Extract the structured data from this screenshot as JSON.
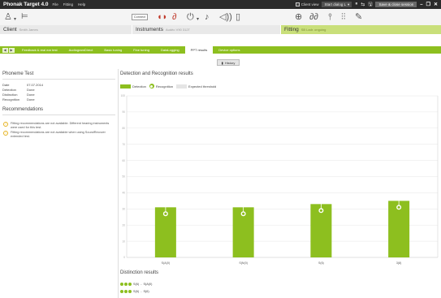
{
  "titlebar": {
    "app_title": "Phonak Target 4.0",
    "menus": [
      "File",
      "Fitting",
      "Help"
    ],
    "client_view_label": "Client view",
    "dropdown_value": "Start dialog L",
    "save_close_label": "Save & close session"
  },
  "iconbar": {
    "connect_label": "Connect"
  },
  "sections": {
    "client": {
      "label": "Client",
      "sub": "Smith James"
    },
    "instruments": {
      "label": "Instruments",
      "sub": "Audéo V90 312T"
    },
    "fitting": {
      "label": "Fitting",
      "sub": "SB Ladr. ongoing"
    }
  },
  "tabs": [
    "Feedback & real ear test",
    "AudiogramDirect",
    "Basic tuning",
    "Fine tuning",
    "DataLogging",
    "PPT results",
    "Device options"
  ],
  "active_tab_index": 5,
  "history_label": "History",
  "left_panel": {
    "title": "Phoneme Test",
    "info": [
      {
        "key": "Date",
        "value": "07.07.2014"
      },
      {
        "key": "Detection",
        "value": "Done"
      },
      {
        "key": "Distinction",
        "value": "Done"
      },
      {
        "key": "Recognition",
        "value": "Done"
      }
    ],
    "recommendations_title": "Recommendations",
    "recommendations": [
      "Fitting recommendations are not available. Different hearing instruments were used for this test.",
      "Fitting recommendations are not available when using SoundRecover extended test."
    ]
  },
  "main": {
    "title": "Detection and Recognition results",
    "legend": {
      "detection": "Detection",
      "recognition": "Recognition",
      "threshold": "Expected threshold"
    },
    "distinction_title": "Distinction results",
    "distinction_rows": [
      {
        "a": "S(6)",
        "b": "S(A(0)"
      },
      {
        "a": "S(6)",
        "b": "S(6)"
      }
    ]
  },
  "colors": {
    "accent_green": "#8dbf1f",
    "fitting_green": "#c9df7a",
    "title_bar": "#2b2b2b"
  },
  "chart_data": {
    "type": "bar",
    "categories": [
      "S(A(0)",
      "S(N(0)",
      "S(6)",
      "3(8)"
    ],
    "ylim": [
      0,
      100
    ],
    "yticks": [
      0,
      10,
      20,
      30,
      40,
      50,
      60,
      70,
      80,
      90,
      100
    ],
    "series": [
      {
        "name": "Detection",
        "values": [
          31,
          31,
          33,
          35
        ]
      },
      {
        "name": "Recognition",
        "values": [
          27,
          27,
          29,
          31
        ]
      }
    ],
    "error_high": [
      33,
      33,
      36,
      38
    ],
    "grid": true,
    "legend_position": "top-left"
  }
}
